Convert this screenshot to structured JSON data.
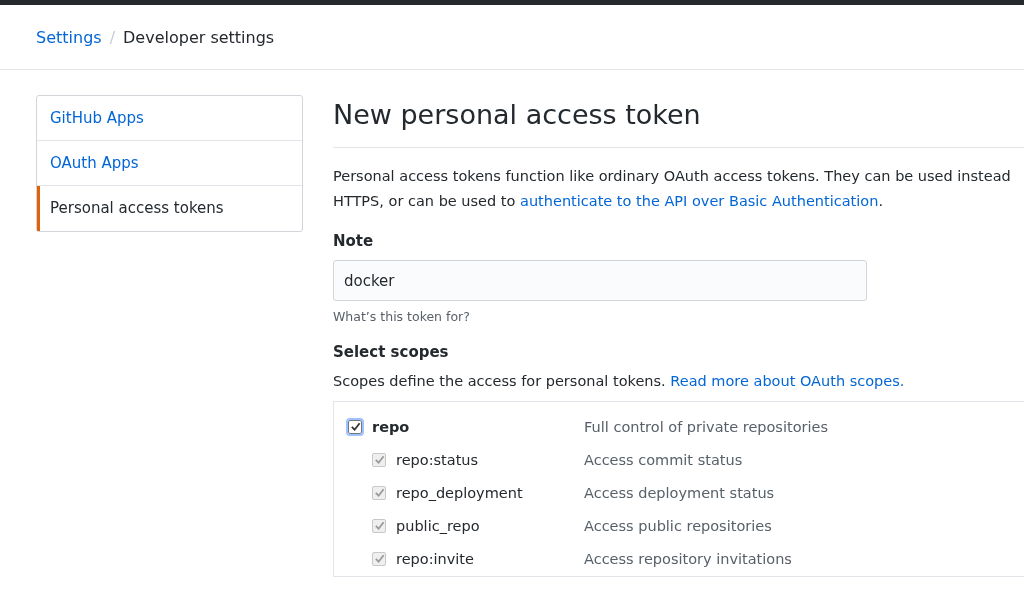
{
  "breadcrumb": {
    "parent": "Settings",
    "separator": "/",
    "current": "Developer settings"
  },
  "sidebar": {
    "items": [
      {
        "label": "GitHub Apps",
        "selected": false
      },
      {
        "label": "OAuth Apps",
        "selected": false
      },
      {
        "label": "Personal access tokens",
        "selected": true
      }
    ]
  },
  "main": {
    "title": "New personal access token",
    "intro": {
      "line_1": "Personal access tokens function like ordinary OAuth access tokens. They can be used instead",
      "line_2": "HTTPS, or can be used to ",
      "link": "authenticate to the API over Basic Authentication",
      "end": "."
    },
    "note": {
      "label": "Note",
      "value": "docker",
      "hint": "What’s this token for?"
    },
    "scopes": {
      "heading": "Select scopes",
      "text": "Scopes define the access for personal tokens. ",
      "link": "Read more about OAuth scopes.",
      "items": [
        {
          "name": "repo",
          "description": "Full control of private repositories",
          "checked": true,
          "disabled": false,
          "children": [
            {
              "name": "repo:status",
              "description": "Access commit status",
              "checked": true,
              "disabled": true
            },
            {
              "name": "repo_deployment",
              "description": "Access deployment status",
              "checked": true,
              "disabled": true
            },
            {
              "name": "public_repo",
              "description": "Access public repositories",
              "checked": true,
              "disabled": true
            },
            {
              "name": "repo:invite",
              "description": "Access repository invitations",
              "checked": true,
              "disabled": true
            }
          ]
        }
      ]
    }
  }
}
